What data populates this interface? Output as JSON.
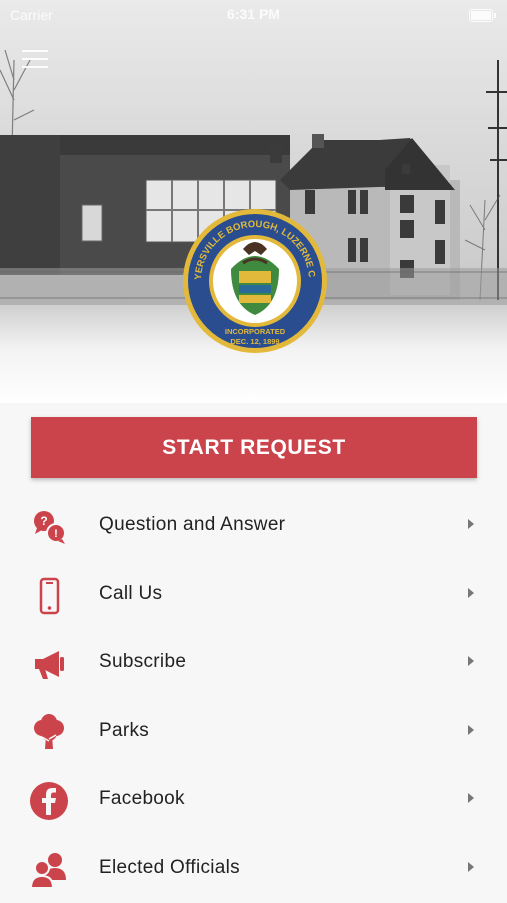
{
  "status_bar": {
    "carrier": "Carrier",
    "time": "6:31 PM"
  },
  "hero": {
    "seal_top_text": "SWOYERSVILLE BOROUGH, LUZERNE CO. PA",
    "seal_line1": "INCORPORATED",
    "seal_line2": "DEC. 12, 1899"
  },
  "start_button": {
    "label": "START REQUEST"
  },
  "menu_items": [
    {
      "label": "Question and Answer",
      "icon": "question-chat-icon"
    },
    {
      "label": "Call Us",
      "icon": "phone-icon"
    },
    {
      "label": "Subscribe",
      "icon": "megaphone-icon"
    },
    {
      "label": "Parks",
      "icon": "tree-icon"
    },
    {
      "label": "Facebook",
      "icon": "facebook-icon"
    },
    {
      "label": "Elected Officials",
      "icon": "users-icon"
    }
  ],
  "colors": {
    "accent": "#cc444b",
    "seal_blue": "#2a4d8f",
    "seal_gold": "#e2b93b"
  }
}
